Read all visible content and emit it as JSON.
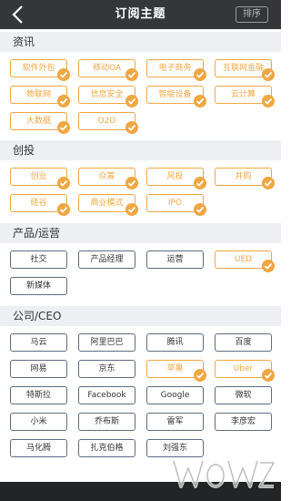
{
  "nav": {
    "title": "订阅主题",
    "sort_label": "排序"
  },
  "sections": [
    {
      "title": "资讯",
      "items": [
        {
          "label": "软件外包",
          "selected": true
        },
        {
          "label": "移动OA",
          "selected": true
        },
        {
          "label": "电子商务",
          "selected": true
        },
        {
          "label": "互联网金融",
          "selected": true
        },
        {
          "label": "物联网",
          "selected": true
        },
        {
          "label": "信息安全",
          "selected": true
        },
        {
          "label": "智能设备",
          "selected": true
        },
        {
          "label": "云计算",
          "selected": true
        },
        {
          "label": "大数据",
          "selected": true
        },
        {
          "label": "O2O",
          "selected": true
        }
      ]
    },
    {
      "title": "创投",
      "items": [
        {
          "label": "创业",
          "selected": true
        },
        {
          "label": "众筹",
          "selected": true
        },
        {
          "label": "风投",
          "selected": true
        },
        {
          "label": "并购",
          "selected": true
        },
        {
          "label": "硅谷",
          "selected": true
        },
        {
          "label": "商业模式",
          "selected": true
        },
        {
          "label": "IPO",
          "selected": true
        }
      ]
    },
    {
      "title": "产品/运营",
      "items": [
        {
          "label": "社交",
          "selected": false
        },
        {
          "label": "产品经理",
          "selected": false
        },
        {
          "label": "运营",
          "selected": false
        },
        {
          "label": "UED",
          "selected": true
        },
        {
          "label": "新媒体",
          "selected": false
        }
      ]
    },
    {
      "title": "公司/CEO",
      "items": [
        {
          "label": "马云",
          "selected": false
        },
        {
          "label": "阿里巴巴",
          "selected": false
        },
        {
          "label": "腾讯",
          "selected": false
        },
        {
          "label": "百度",
          "selected": false
        },
        {
          "label": "网易",
          "selected": false
        },
        {
          "label": "京东",
          "selected": false
        },
        {
          "label": "苹果",
          "selected": true
        },
        {
          "label": "Uber",
          "selected": true
        },
        {
          "label": "特斯拉",
          "selected": false
        },
        {
          "label": "Facebook",
          "selected": false
        },
        {
          "label": "Google",
          "selected": false
        },
        {
          "label": "微软",
          "selected": false
        },
        {
          "label": "小米",
          "selected": false
        },
        {
          "label": "乔布斯",
          "selected": false
        },
        {
          "label": "雷军",
          "selected": false
        },
        {
          "label": "李彦宏",
          "selected": false
        },
        {
          "label": "马化腾",
          "selected": false
        },
        {
          "label": "扎克伯格",
          "selected": false
        },
        {
          "label": "刘强东",
          "selected": false
        }
      ]
    }
  ],
  "colors": {
    "accent": "#f0a743",
    "nav_bg": "#34363a",
    "section_bg": "#eeeff3",
    "chip_border_off": "#5d6d85"
  },
  "icons": {
    "back": "chevron-left-icon",
    "selected": "check-circle-icon"
  }
}
